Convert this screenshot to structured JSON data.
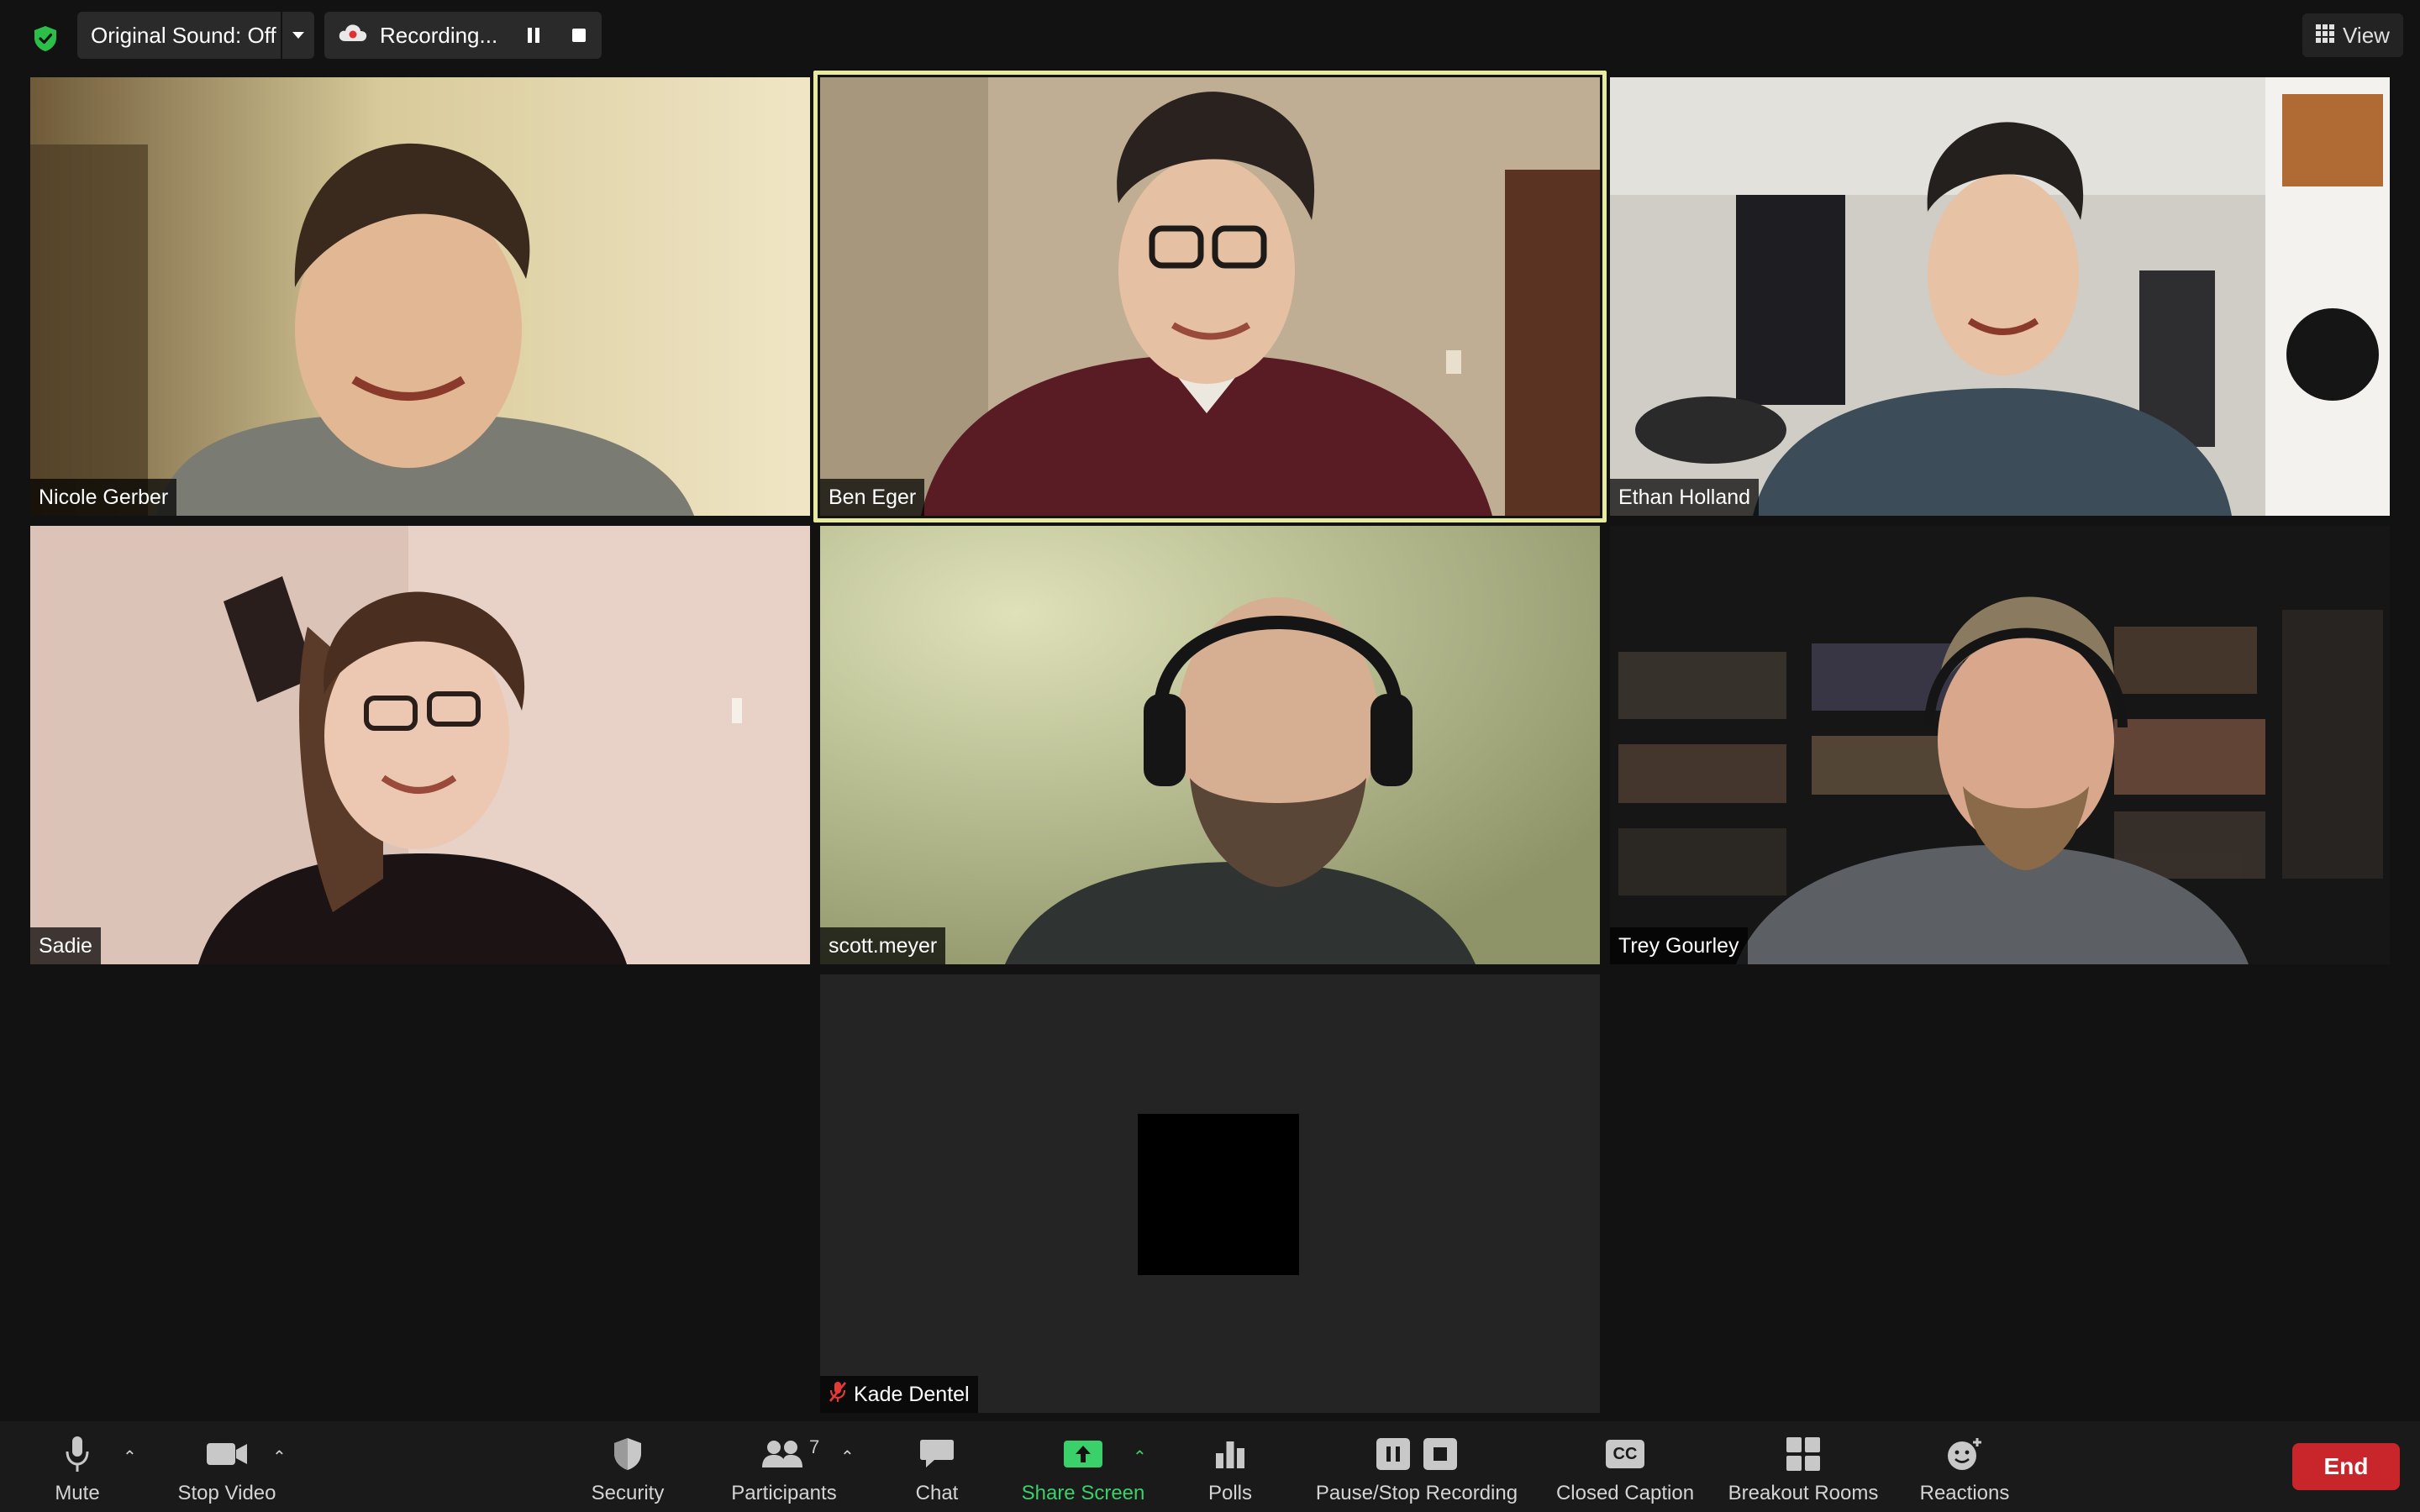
{
  "topbar": {
    "security_icon": "shield-check-icon",
    "original_sound_label": "Original Sound: Off",
    "recording_label": "Recording...",
    "view_label": "View"
  },
  "participants": [
    {
      "name": "Nicole Gerber"
    },
    {
      "name": "Ben Eger",
      "active_speaker": true
    },
    {
      "name": "Ethan Holland"
    },
    {
      "name": "Sadie"
    },
    {
      "name": "scott.meyer"
    },
    {
      "name": "Trey Gourley"
    },
    {
      "name": "Kade Dentel",
      "muted": true,
      "video_off": true
    }
  ],
  "toolbar": {
    "mute_label": "Mute",
    "stop_video_label": "Stop Video",
    "security_label": "Security",
    "participants_label": "Participants",
    "participants_count": "7",
    "chat_label": "Chat",
    "share_screen_label": "Share Screen",
    "polls_label": "Polls",
    "pause_stop_recording_label": "Pause/Stop Recording",
    "closed_caption_label": "Closed Caption",
    "closed_caption_badge": "CC",
    "breakout_rooms_label": "Breakout Rooms",
    "reactions_label": "Reactions",
    "end_label": "End"
  },
  "colors": {
    "background": "#121212",
    "toolbar": "#1a1a1a",
    "active_speaker_border": "#e6eb9e",
    "share_green": "#3ad06a",
    "end_red": "#c8262a",
    "security_green": "#2bbf4a"
  }
}
